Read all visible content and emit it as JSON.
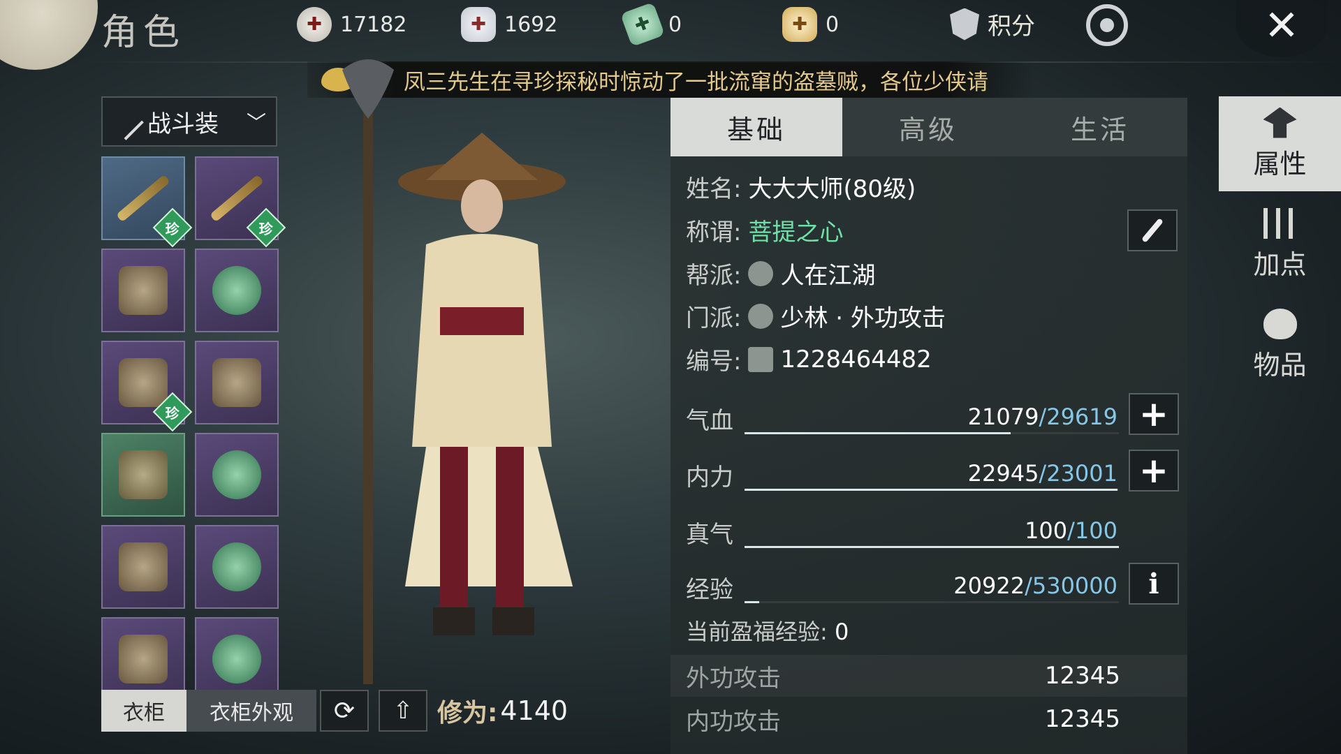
{
  "header": {
    "title": "角色",
    "currencies": [
      {
        "icon": "copper-coin-icon",
        "value": "17182"
      },
      {
        "icon": "silver-ingot-icon",
        "value": "1692"
      },
      {
        "icon": "jade-token-icon",
        "value": "0"
      },
      {
        "icon": "gold-ingot-icon",
        "value": "0"
      }
    ],
    "score_label": "积分"
  },
  "notice": {
    "text": "凤三先生在寻珍探秘时惊动了一批流窜的盗墓贼，各位少侠请"
  },
  "outfit": {
    "selected": "战斗装"
  },
  "equipment": {
    "badge_text": "珍",
    "slots": [
      {
        "icon": "spear-weapon-icon",
        "rarity": "blue",
        "badge": true
      },
      {
        "icon": "spear-weapon-alt-icon",
        "rarity": "purple",
        "badge": true
      },
      {
        "icon": "bamboo-hat-icon",
        "rarity": "purple",
        "badge": false
      },
      {
        "icon": "jade-pendant-icon",
        "rarity": "purple",
        "badge": false
      },
      {
        "icon": "armor-robe-icon",
        "rarity": "purple",
        "badge": true
      },
      {
        "icon": "bracer-icon",
        "rarity": "purple",
        "badge": false
      },
      {
        "icon": "belt-icon",
        "rarity": "green",
        "badge": false
      },
      {
        "icon": "jade-bracelet-icon",
        "rarity": "purple",
        "badge": false
      },
      {
        "icon": "skirt-icon",
        "rarity": "purple",
        "badge": false
      },
      {
        "icon": "jade-ring-icon",
        "rarity": "purple",
        "badge": false
      },
      {
        "icon": "boots-icon",
        "rarity": "purple",
        "badge": false
      },
      {
        "icon": "crescent-pendant-icon",
        "rarity": "purple",
        "badge": false
      }
    ]
  },
  "wardrobe": {
    "tab_active": "衣柜",
    "tab_inactive": "衣柜外观",
    "cultivation_label": "修为:",
    "cultivation_value": "4140"
  },
  "tabs": [
    "基础",
    "高级",
    "生活"
  ],
  "profile": {
    "name_label": "姓名:",
    "name_value": "大大大师(80级)",
    "title_label": "称谓:",
    "title_value": "菩提之心",
    "guild_label": "帮派:",
    "guild_value": "人在江湖",
    "sect_label": "门派:",
    "sect_value": "少林 · 外功攻击",
    "id_label": "编号:",
    "id_value": "1228464482"
  },
  "stats": [
    {
      "label": "气血",
      "current": "21079",
      "max": "/29619",
      "fill": 0.71,
      "has_plus": true
    },
    {
      "label": "内力",
      "current": "22945",
      "max": "/23001",
      "fill": 0.997,
      "has_plus": true
    },
    {
      "label": "真气",
      "current": "100",
      "max": "/100",
      "fill": 1.0,
      "has_plus": false
    },
    {
      "label": "经验",
      "current": "20922",
      "max": "/530000",
      "fill": 0.04,
      "has_plus": false
    }
  ],
  "exp_bonus": {
    "label": "当前盈福经验:",
    "value": "0"
  },
  "attributes": [
    {
      "label": "外功攻击",
      "value": "12345"
    },
    {
      "label": "内功攻击",
      "value": "12345"
    }
  ],
  "side_nav": [
    {
      "label": "属性",
      "icon": "scholar-hat-icon",
      "active": true
    },
    {
      "label": "加点",
      "icon": "sliders-icon",
      "active": false
    },
    {
      "label": "物品",
      "icon": "bag-icon",
      "active": false
    }
  ],
  "colors": {
    "accent_green": "#6fe0a6",
    "max_blue": "#86c7e8",
    "gold_text": "#e3c98b"
  }
}
